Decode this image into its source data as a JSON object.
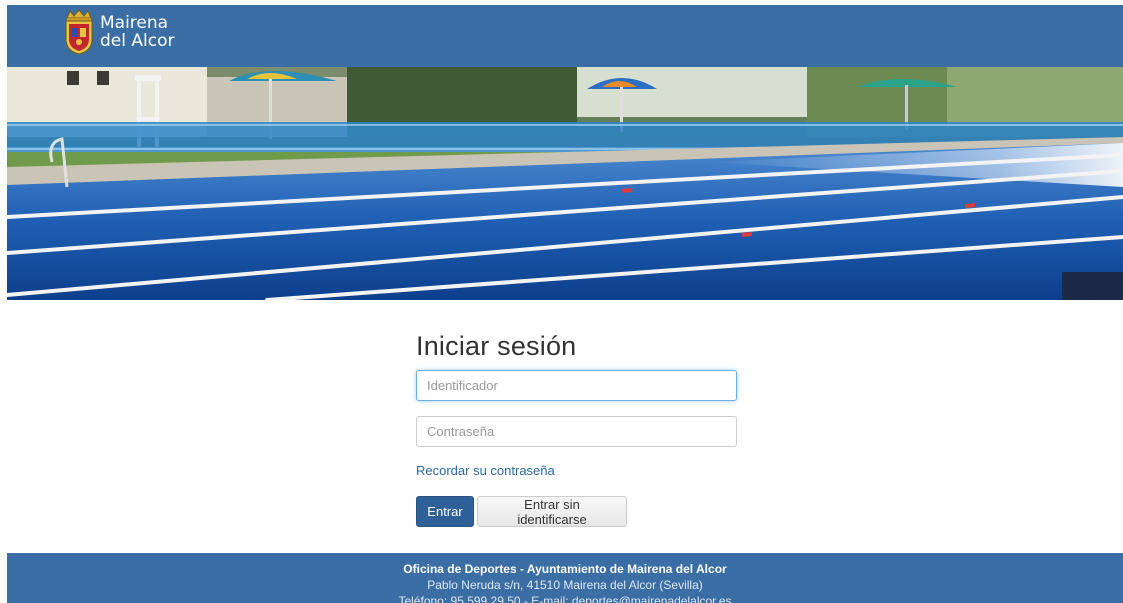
{
  "header": {
    "logo_line1": "Mairena",
    "logo_line2": "del Alcor"
  },
  "login": {
    "title": "Iniciar sesión",
    "user_placeholder": "Identificador",
    "user_value": "",
    "password_placeholder": "Contraseña",
    "password_value": "",
    "forgot_link": "Recordar su contraseña",
    "submit_label": "Entrar",
    "guest_label": "Entrar sin identificarse"
  },
  "footer": {
    "title": "Oficina de Deportes - Ayuntamiento de Mairena del Alcor",
    "address": "Pablo Neruda s/n, 41510 Mairena del Alcor (Sevilla)",
    "contact": "Teléfono: 95 599 29 50 - E-mail: deportes@mairenadelalcor.es"
  },
  "colors": {
    "header_bg": "#3a6ea5",
    "primary_button": "#2f6199",
    "link": "#2a6aa8"
  },
  "icons": {
    "logo": "coat-of-arms-icon"
  }
}
